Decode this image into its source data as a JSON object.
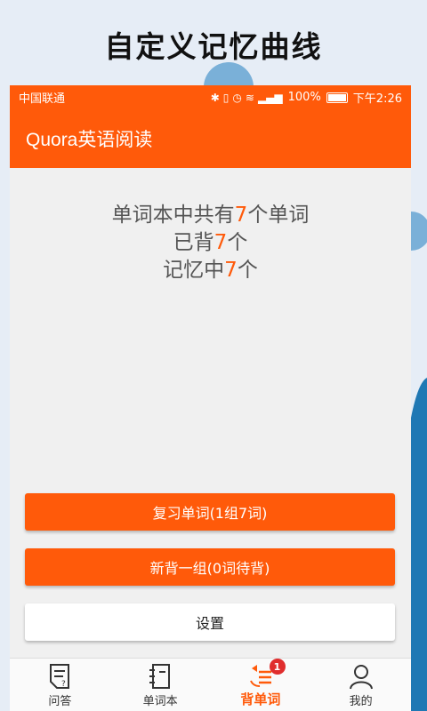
{
  "promo": {
    "title": "自定义记忆曲线"
  },
  "status_bar": {
    "carrier": "中国联通",
    "icons": [
      "bluetooth-icon",
      "vibrate-icon",
      "alarm-icon",
      "wifi-icon",
      "signal-4g-icon"
    ],
    "battery": "100%",
    "time": "下午2:26"
  },
  "app_bar": {
    "title": "Quora英语阅读"
  },
  "stats": {
    "line1_prefix": "单词本中共有",
    "line1_value": "7",
    "line1_suffix": "个单词",
    "line2_prefix": "已背",
    "line2_value": "7",
    "line2_suffix": "个",
    "line3_prefix": "记忆中",
    "line3_value": "7",
    "line3_suffix": "个"
  },
  "buttons": {
    "review": "复习单词(1组7词)",
    "new_group": "新背一组(0词待背)",
    "settings": "设置"
  },
  "tabbar": {
    "items": [
      {
        "label": "问答",
        "icon": "qa-icon"
      },
      {
        "label": "单词本",
        "icon": "notebook-icon"
      },
      {
        "label": "背单词",
        "icon": "memorize-icon",
        "badge": "1",
        "active": true
      },
      {
        "label": "我的",
        "icon": "profile-icon"
      }
    ]
  },
  "colors": {
    "accent": "#ff5a0a",
    "badge": "#e02d2d",
    "background": "#f0f0f0"
  }
}
